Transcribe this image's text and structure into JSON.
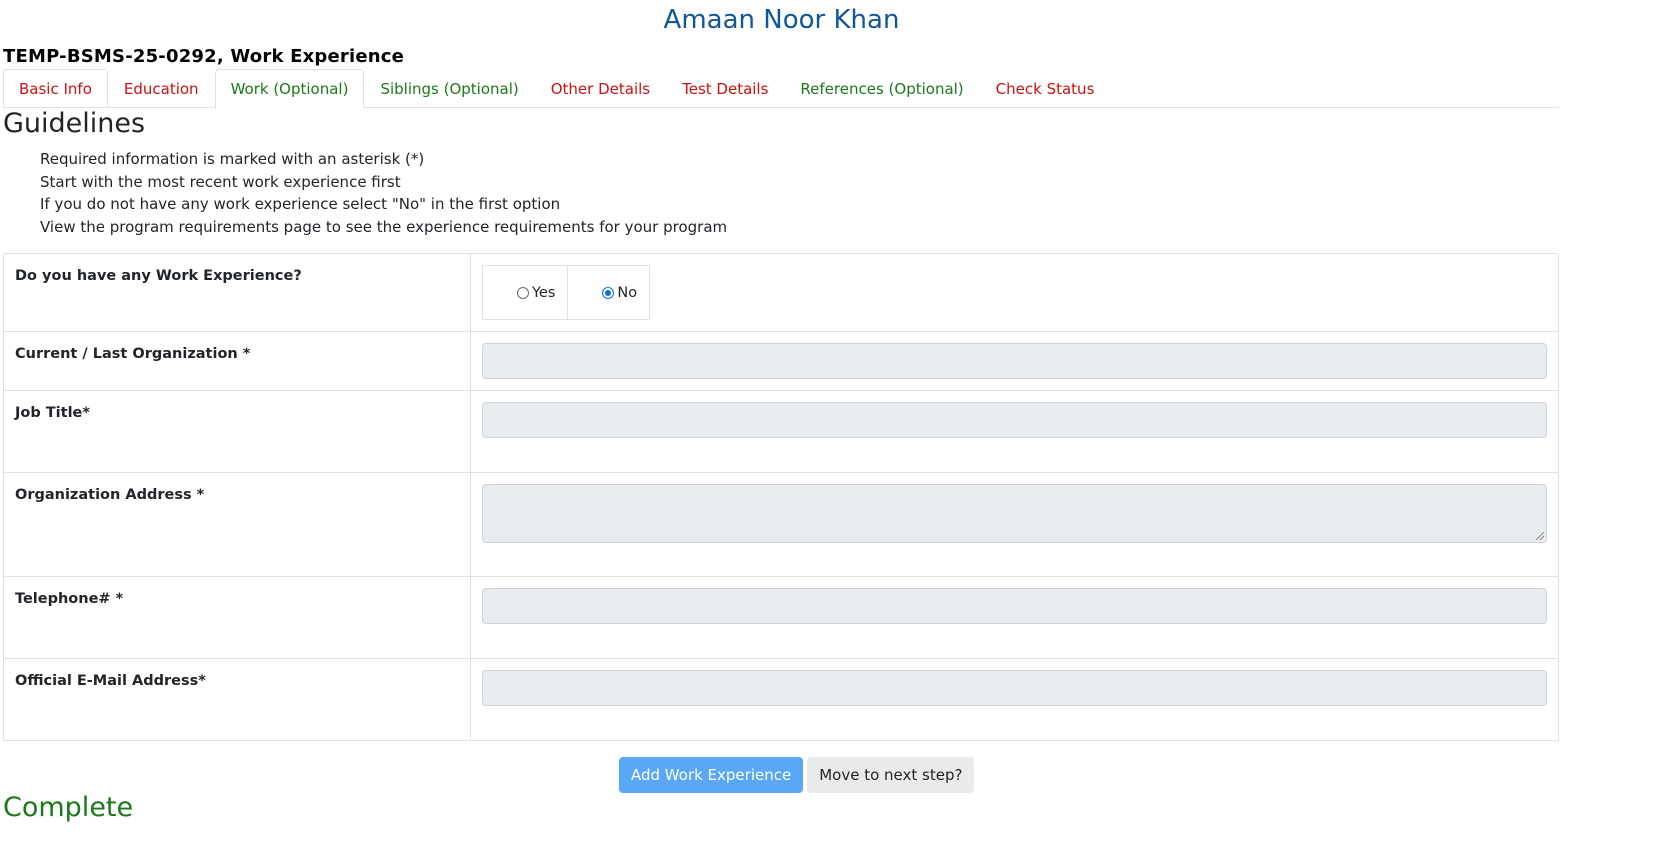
{
  "header": {
    "title": "Amaan Noor Khan",
    "application_line": "TEMP-BSMS-25-0292, Work Experience",
    "title_color": "#11569b"
  },
  "tabs": [
    {
      "label": "Basic Info",
      "status": "red"
    },
    {
      "label": "Education",
      "status": "red"
    },
    {
      "label": "Work (Optional)",
      "status": "green",
      "active": true
    },
    {
      "label": "Siblings (Optional)",
      "status": "green"
    },
    {
      "label": "Other Details",
      "status": "red"
    },
    {
      "label": "Test Details",
      "status": "red"
    },
    {
      "label": "References (Optional)",
      "status": "green"
    },
    {
      "label": "Check Status",
      "status": "red"
    }
  ],
  "guidelines": {
    "heading": "Guidelines",
    "items": [
      "Required information is marked with an asterisk (*)",
      "Start with the most recent work experience first",
      "If you do not have any work experience select \"No\" in the first option",
      "View the program requirements page to see the experience requirements for your program"
    ]
  },
  "form": {
    "work_experience_question": "Do you have any Work Experience?",
    "options": {
      "yes": "Yes",
      "no": "No",
      "selected": "No"
    },
    "organization_label": "Current / Last Organization *",
    "organization_value": "",
    "job_title_label": "Job Title*",
    "job_title_value": "",
    "address_label": "Organization Address *",
    "address_value": "",
    "telephone_label": "Telephone# *",
    "telephone_value": "",
    "email_label": "Official E-Mail Address*",
    "email_value": ""
  },
  "actions": {
    "add_label": "Add Work Experience",
    "next_label": "Move to next step?"
  },
  "footer": {
    "complete_heading": "Complete"
  },
  "colors": {
    "tab_incomplete": "#cc1111",
    "tab_complete": "#1a7a1a",
    "primary_button": "#5aa7f5"
  }
}
